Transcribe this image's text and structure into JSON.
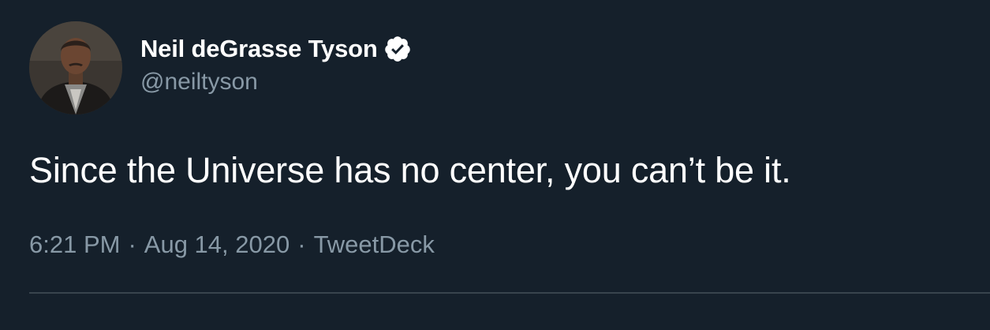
{
  "author": {
    "display_name": "Neil deGrasse Tyson",
    "handle": "@neiltyson",
    "verified": true,
    "avatar": "profile-photo"
  },
  "tweet": {
    "text": "Since the Universe has no center, you can’t be it.",
    "time": "6:21 PM",
    "date": "Aug 14, 2020",
    "source": "TweetDeck",
    "separator": "·"
  },
  "colors": {
    "background": "#15202b",
    "primary_text": "#ffffff",
    "secondary_text": "#8899a6",
    "divider": "#38444d",
    "verified_badge": "#ffffff"
  }
}
